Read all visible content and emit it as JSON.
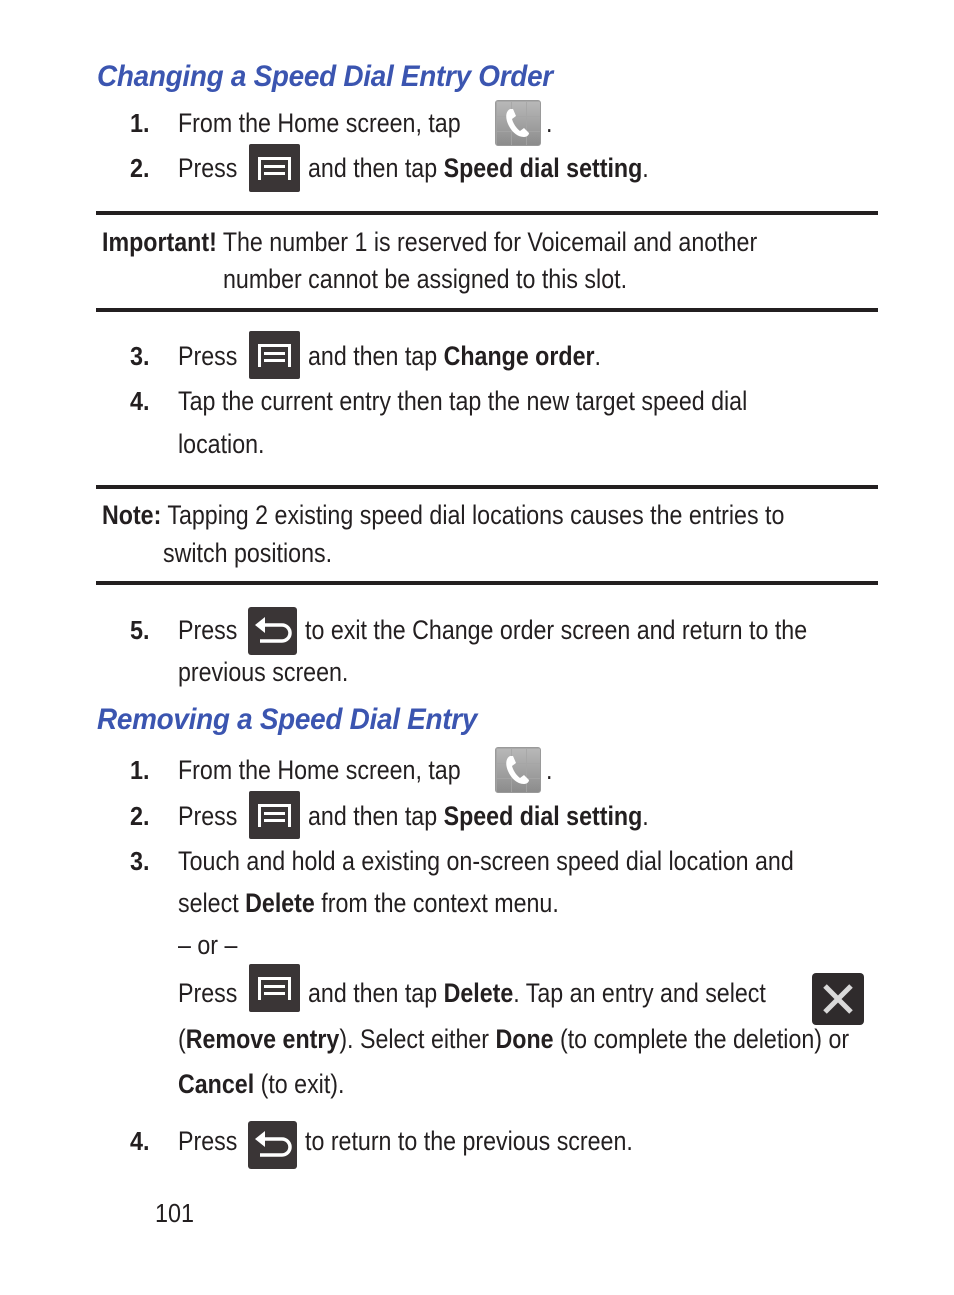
{
  "section1": {
    "title": "Changing a Speed Dial Entry Order",
    "steps": [
      {
        "num": "1.",
        "pre": "From the Home screen, tap",
        "post": ".",
        "icon": "phone-icon"
      },
      {
        "num": "2.",
        "pre": "Press",
        "mid": "and then tap",
        "bold": "Speed dial setting",
        "post": ".",
        "icon": "menu-icon"
      },
      {
        "num": "3.",
        "pre": "Press",
        "mid": "and then tap",
        "bold": "Change order",
        "post": ".",
        "icon": "menu-icon"
      },
      {
        "num": "4.",
        "line1": "Tap the current entry then tap the new target speed dial",
        "line2": "location."
      },
      {
        "num": "5.",
        "pre": "Press",
        "mid": "to exit the Change order screen and return to the",
        "line2": "previous screen.",
        "icon": "back-icon"
      }
    ],
    "important": {
      "label": "Important!",
      "line1": "The number 1 is reserved for Voicemail and another",
      "line2": "number cannot be assigned to this slot."
    },
    "note": {
      "label": "Note:",
      "line1": "Tapping 2 existing speed dial locations causes the entries to",
      "line2": "switch positions."
    }
  },
  "section2": {
    "title": "Removing a Speed Dial Entry",
    "steps": [
      {
        "num": "1.",
        "pre": "From the Home screen, tap",
        "post": ".",
        "icon": "phone-icon"
      },
      {
        "num": "2.",
        "pre": "Press",
        "mid": "and then tap",
        "bold": "Speed dial setting",
        "post": ".",
        "icon": "menu-icon"
      },
      {
        "num": "3.",
        "line1": "Touch and hold a existing on-screen speed dial location and",
        "line2_pre": "select",
        "line2_bold": "Delete",
        "line2_post": "from the context menu.",
        "or": "– or –",
        "alt_pre": "Press",
        "alt_mid": "and then tap",
        "alt_bold": "Delete",
        "alt_post": ". Tap an entry and select",
        "l5_open": "(",
        "l5_bold1": "Remove entry",
        "l5_mid": "). Select either",
        "l5_bold2": "Done",
        "l5_post": "(to complete the deletion) or",
        "l6_bold": "Cancel",
        "l6_post": "(to exit)."
      },
      {
        "num": "4.",
        "pre": "Press",
        "mid": "to return to the previous screen.",
        "icon": "back-icon"
      }
    ]
  },
  "footer": {
    "page_number": "101"
  },
  "colors": {
    "heading": "#3b55b0",
    "text": "#231f20",
    "icon_bg": "#3a3536"
  }
}
